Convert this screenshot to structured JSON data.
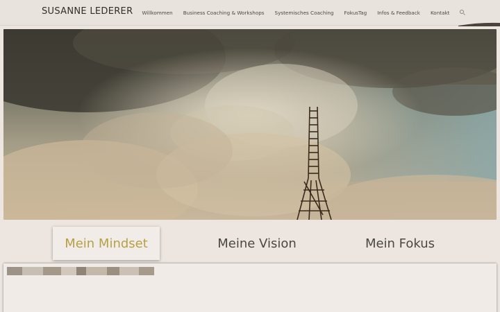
{
  "header": {
    "brand": "SUSANNE LEDERER",
    "nav": [
      "Willkommen",
      "Business Coaching & Workshops",
      "Systemisches Coaching",
      "FokusTag",
      "Infos & Feedback",
      "Kontakt"
    ]
  },
  "hero": {
    "icon": "ladder-in-clouds-image"
  },
  "tabs": [
    {
      "label": "Mein Mindset",
      "active": true
    },
    {
      "label": "Meine Vision",
      "active": false
    },
    {
      "label": "Mein Fokus",
      "active": false
    }
  ],
  "colors": {
    "background": "#ede6e0",
    "accent": "#b5a046",
    "text": "#4a4743"
  }
}
